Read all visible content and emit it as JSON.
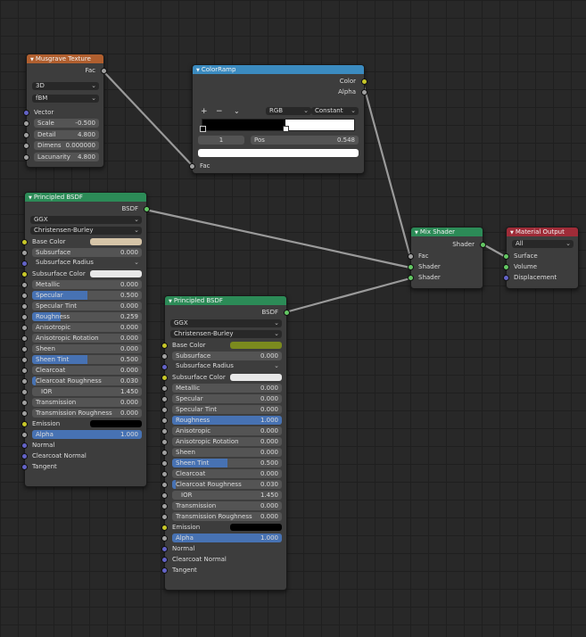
{
  "colors": {
    "canvas": "#282828",
    "grid": "#1f1f1f",
    "node_body": "#3d3d3d",
    "header_texture": "#b05f2f",
    "header_converter": "#3b8bc0",
    "header_shader": "#2c8b57",
    "header_output": "#9f2c38",
    "socket_float": "#a1a1a1",
    "socket_color": "#c7c729",
    "socket_shader": "#63c763",
    "socket_vector": "#6363c7",
    "field_fill": "#4772b3"
  },
  "musgrave": {
    "title": "Musgrave Texture",
    "output": "Fac",
    "dim_select": "3D",
    "type_select": "fBM",
    "vector_label": "Vector",
    "fields": [
      {
        "label": "Scale",
        "value": "-0.500"
      },
      {
        "label": "Detail",
        "value": "4.800"
      },
      {
        "label": "Dimens",
        "value": "0.000000"
      },
      {
        "label": "Lacunarity",
        "value": "4.800"
      }
    ]
  },
  "colorramp": {
    "title": "ColorRamp",
    "outputs": [
      "Color",
      "Alpha"
    ],
    "add_icon": "plus-icon",
    "remove_icon": "minus-icon",
    "mode_select": "RGB",
    "interp_select": "Constant",
    "stop_index": "1",
    "pos_label": "Pos",
    "pos_value": "0.548",
    "input": "Fac"
  },
  "bsdf1": {
    "title": "Principled BSDF",
    "output": "BSDF",
    "distribution": "GGX",
    "sss_method": "Christensen-Burley",
    "base_color_label": "Base Color",
    "base_color": "#d6c5a8",
    "subsurface": {
      "label": "Subsurface",
      "value": "0.000",
      "fill": 0
    },
    "subsurface_radius": "Subsurface Radius",
    "subsurface_color_label": "Subsurface Color",
    "subsurface_color": "#e8e8e8",
    "fields": [
      {
        "label": "Metallic",
        "value": "0.000",
        "fill": 0
      },
      {
        "label": "Specular",
        "value": "0.500",
        "fill": 0.5
      },
      {
        "label": "Specular Tint",
        "value": "0.000",
        "fill": 0
      },
      {
        "label": "Roughness",
        "value": "0.259",
        "fill": 0.259
      },
      {
        "label": "Anisotropic",
        "value": "0.000",
        "fill": 0
      },
      {
        "label": "Anisotropic Rotation",
        "value": "0.000",
        "fill": 0
      },
      {
        "label": "Sheen",
        "value": "0.000",
        "fill": 0
      },
      {
        "label": "Sheen Tint",
        "value": "0.500",
        "fill": 0.5
      },
      {
        "label": "Clearcoat",
        "value": "0.000",
        "fill": 0
      },
      {
        "label": "Clearcoat Roughness",
        "value": "0.030",
        "fill": 0.03
      }
    ],
    "ior": {
      "label": "IOR",
      "value": "1.450"
    },
    "fields2": [
      {
        "label": "Transmission",
        "value": "0.000",
        "fill": 0
      },
      {
        "label": "Transmission Roughness",
        "value": "0.000",
        "fill": 0
      }
    ],
    "emission_label": "Emission",
    "emission_color": "#000000",
    "alpha": {
      "label": "Alpha",
      "value": "1.000",
      "fill": 1
    },
    "vector_inputs": [
      "Normal",
      "Clearcoat Normal",
      "Tangent"
    ]
  },
  "bsdf2": {
    "title": "Principled BSDF",
    "output": "BSDF",
    "distribution": "GGX",
    "sss_method": "Christensen-Burley",
    "base_color_label": "Base Color",
    "base_color": "#7b8a1e",
    "subsurface": {
      "label": "Subsurface",
      "value": "0.000",
      "fill": 0
    },
    "subsurface_radius": "Subsurface Radius",
    "subsurface_color_label": "Subsurface Color",
    "subsurface_color": "#e8e8e8",
    "fields": [
      {
        "label": "Metallic",
        "value": "0.000",
        "fill": 0
      },
      {
        "label": "Specular",
        "value": "0.000",
        "fill": 0
      },
      {
        "label": "Specular Tint",
        "value": "0.000",
        "fill": 0
      },
      {
        "label": "Roughness",
        "value": "1.000",
        "fill": 1
      },
      {
        "label": "Anisotropic",
        "value": "0.000",
        "fill": 0
      },
      {
        "label": "Anisotropic Rotation",
        "value": "0.000",
        "fill": 0
      },
      {
        "label": "Sheen",
        "value": "0.000",
        "fill": 0
      },
      {
        "label": "Sheen Tint",
        "value": "0.500",
        "fill": 0.5
      },
      {
        "label": "Clearcoat",
        "value": "0.000",
        "fill": 0
      },
      {
        "label": "Clearcoat Roughness",
        "value": "0.030",
        "fill": 0.03
      }
    ],
    "ior": {
      "label": "IOR",
      "value": "1.450"
    },
    "fields2": [
      {
        "label": "Transmission",
        "value": "0.000",
        "fill": 0
      },
      {
        "label": "Transmission Roughness",
        "value": "0.000",
        "fill": 0
      }
    ],
    "emission_label": "Emission",
    "emission_color": "#000000",
    "alpha": {
      "label": "Alpha",
      "value": "1.000",
      "fill": 1
    },
    "vector_inputs": [
      "Normal",
      "Clearcoat Normal",
      "Tangent"
    ]
  },
  "mixshader": {
    "title": "Mix Shader",
    "output": "Shader",
    "inputs": [
      "Fac",
      "Shader",
      "Shader"
    ]
  },
  "matout": {
    "title": "Material Output",
    "target": "All",
    "inputs": [
      "Surface",
      "Volume",
      "Displacement"
    ]
  }
}
